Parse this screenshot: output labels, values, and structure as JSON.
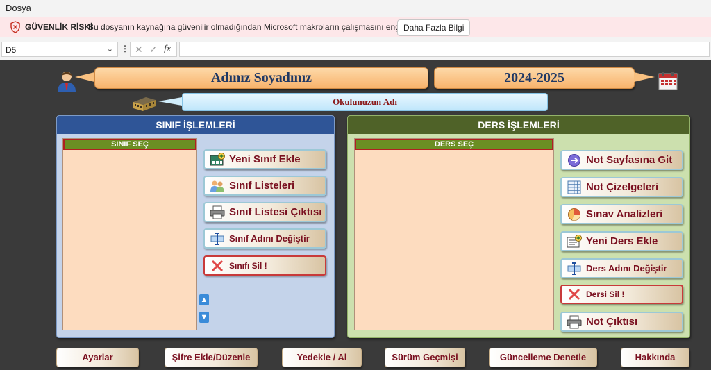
{
  "menubar": {
    "file": "Dosya"
  },
  "security": {
    "title": "GÜVENLİK RİSKİ",
    "message": "Bu dosyanın kaynağına güvenilir olmadığından Microsoft makroların çalışmasını engelledi.",
    "button": "Daha Fazla Bilgi"
  },
  "formula_bar": {
    "cell_ref": "D5",
    "fx": "fx",
    "content": ""
  },
  "header": {
    "name": "Adınız Soyadınız",
    "year": "2024-2025",
    "school": "Okulunuzun Adı"
  },
  "sinif": {
    "title": "SINIF İŞLEMLERİ",
    "list_title": "SINIF SEÇ",
    "buttons": {
      "add": "Yeni Sınıf Ekle",
      "lists": "Sınıf Listeleri",
      "print": "Sınıf Listesi Çıktısı",
      "rename": "Sınıf Adını Değiştir",
      "delete": "Sınıfı Sil !"
    }
  },
  "ders": {
    "title": "DERS İŞLEMLERİ",
    "list_title": "DERS SEÇ",
    "buttons": {
      "goto": "Not Sayfasına Git",
      "charts": "Not Çizelgeleri",
      "analysis": "Sınav Analizleri",
      "add": "Yeni Ders Ekle",
      "rename": "Ders Adını Değiştir",
      "delete": "Dersi Sil !",
      "print": "Not Çıktısı"
    }
  },
  "bottom": {
    "settings": "Ayarlar",
    "password": "Şifre Ekle/Düzenle",
    "backup": "Yedekle / Al",
    "history": "Sürüm Geçmişi",
    "update": "Güncelleme Denetle",
    "about": "Hakkında"
  },
  "colors": {
    "sheet_bg": "#3a3a3a",
    "sinif_header": "#2f5597",
    "ders_header": "#4f6228",
    "button_text": "#7a1020",
    "banner_text": "#1f3864"
  }
}
